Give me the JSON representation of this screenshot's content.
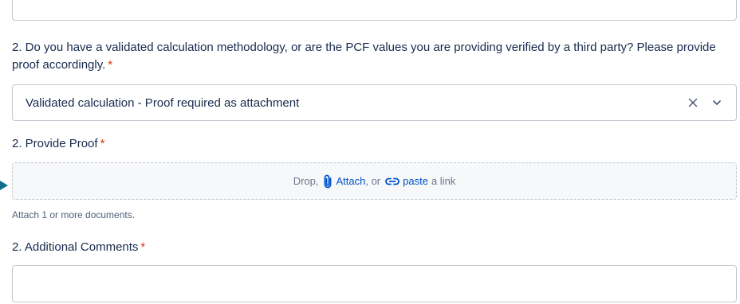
{
  "question": {
    "text": "2. Do you have a validated calculation methodology, or are the PCF values you are providing verified by a third party? Please provide proof accordingly.",
    "required_marker": "*"
  },
  "methodology_select": {
    "value": "Validated calculation - Proof required as attachment",
    "clear_icon": "close-icon",
    "chevron_icon": "chevron-down-icon"
  },
  "proof": {
    "label": "2. Provide Proof",
    "required_marker": "*",
    "dropzone": {
      "drop_text": "Drop,",
      "attach_label": "Attach",
      "or_text": ", or",
      "paste_label": "paste",
      "link_text": "a link",
      "attach_icon": "paperclip-icon",
      "link_icon": "link-icon"
    },
    "helper": "Attach 1 or more documents."
  },
  "comments": {
    "label": "2. Additional Comments",
    "required_marker": "*",
    "value": ""
  },
  "colors": {
    "accent": "#0052cc",
    "required": "#de350b",
    "border": "#c1c7d0",
    "text": "#172b4d",
    "arrow": "#0e6f8a"
  }
}
